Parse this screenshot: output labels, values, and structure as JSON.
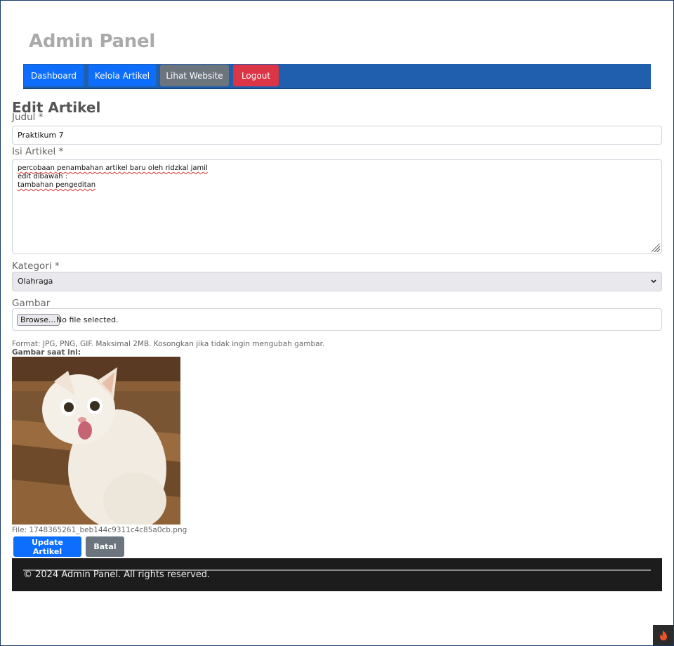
{
  "app": {
    "brand": "Admin Panel"
  },
  "nav": {
    "items": [
      {
        "label": "Dashboard",
        "color": "#0d6efd"
      },
      {
        "label": "Kelola Artikel",
        "color": "#0d6efd"
      },
      {
        "label": "Lihat Website",
        "color": "#6c757d"
      },
      {
        "label": "Logout",
        "color": "#dc3545"
      }
    ],
    "bar_color": "#1f5fad"
  },
  "form": {
    "title": "Edit Artikel",
    "judul_label": "Judul *",
    "judul_value": "Praktikum 7",
    "isi_label": "Isi Artikel *",
    "isi_lines": [
      "percobaan penambahan artikel baru oleh ridzkal jamil",
      "edit dibawah :",
      "tambahan pengeditan"
    ],
    "kategori_label": "Kategori *",
    "kategori_selected": "Olahraga",
    "gambar_label": "Gambar",
    "browse_label": "Browse...",
    "no_file_text": "No file selected.",
    "hint": "Format: JPG, PNG, GIF. Maksimal 2MB. Kosongkan jika tidak ingin mengubah gambar.",
    "current_image_label": "Gambar saat ini:",
    "file_name": "File: 1748365261_beb144c9311c4c85a0cb.png",
    "update_button": "Update Artikel",
    "cancel_button": "Batal"
  },
  "footer": {
    "text": "© 2024 Admin Panel. All rights reserved."
  },
  "icons": {
    "dropdown": "chevron-down-icon",
    "corner": "flame-icon",
    "resize": "resize-grip-icon"
  }
}
